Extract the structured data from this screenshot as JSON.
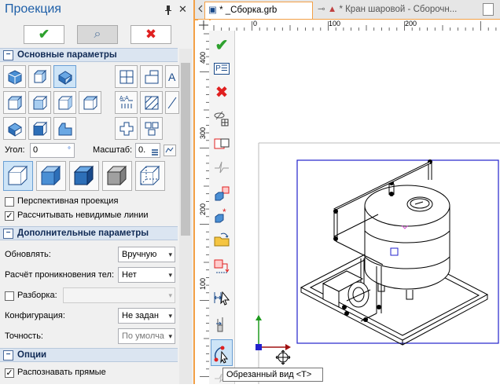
{
  "panel": {
    "title": "Проекция",
    "pin_glyph": "ᵽ",
    "close_glyph": "✕",
    "buttons": {
      "ok": "✔",
      "preview": "⌕",
      "cancel": "✖"
    },
    "sections": {
      "main": "Основные параметры",
      "extra": "Дополнительные параметры",
      "options": "Опции"
    },
    "angle_label": "Угол:",
    "angle_value": "0",
    "angle_unit": "°",
    "scale_label": "Масштаб:",
    "scale_value": "0.",
    "perspective_label": "Перспективная проекция",
    "perspective_checked": false,
    "hidden_lines_label": "Рассчитывать невидимые линии",
    "hidden_lines_checked": true,
    "update_label": "Обновлять:",
    "update_value": "Вручную",
    "penetration_label": "Расчёт проникновения тел:",
    "penetration_value": "Нет",
    "explode_label": "Разборка:",
    "explode_checked": false,
    "config_label": "Конфигурация:",
    "config_value": "Не задан",
    "accuracy_label": "Точность:",
    "accuracy_value": "По умолча",
    "recognize_label": "Распознавать прямые",
    "recognize_checked": true
  },
  "tabs": [
    {
      "label": "* _Сборка.grb",
      "active": true
    },
    {
      "label": "* Кран шаровой - Сборочн...",
      "active": false
    }
  ],
  "ruler": {
    "h": [
      "0",
      "100",
      "200"
    ],
    "v": [
      "400",
      "300",
      "200",
      "100"
    ]
  },
  "toolbar": {
    "ok_glyph": "✔",
    "cancel_glyph": "✖",
    "p_label": "P☰"
  },
  "tooltip": "Обрезанный вид   <T>",
  "colors": {
    "accent": "#f3a046",
    "ok": "#2ea12e",
    "cancel": "#e02020",
    "frame": "#2222cc"
  }
}
